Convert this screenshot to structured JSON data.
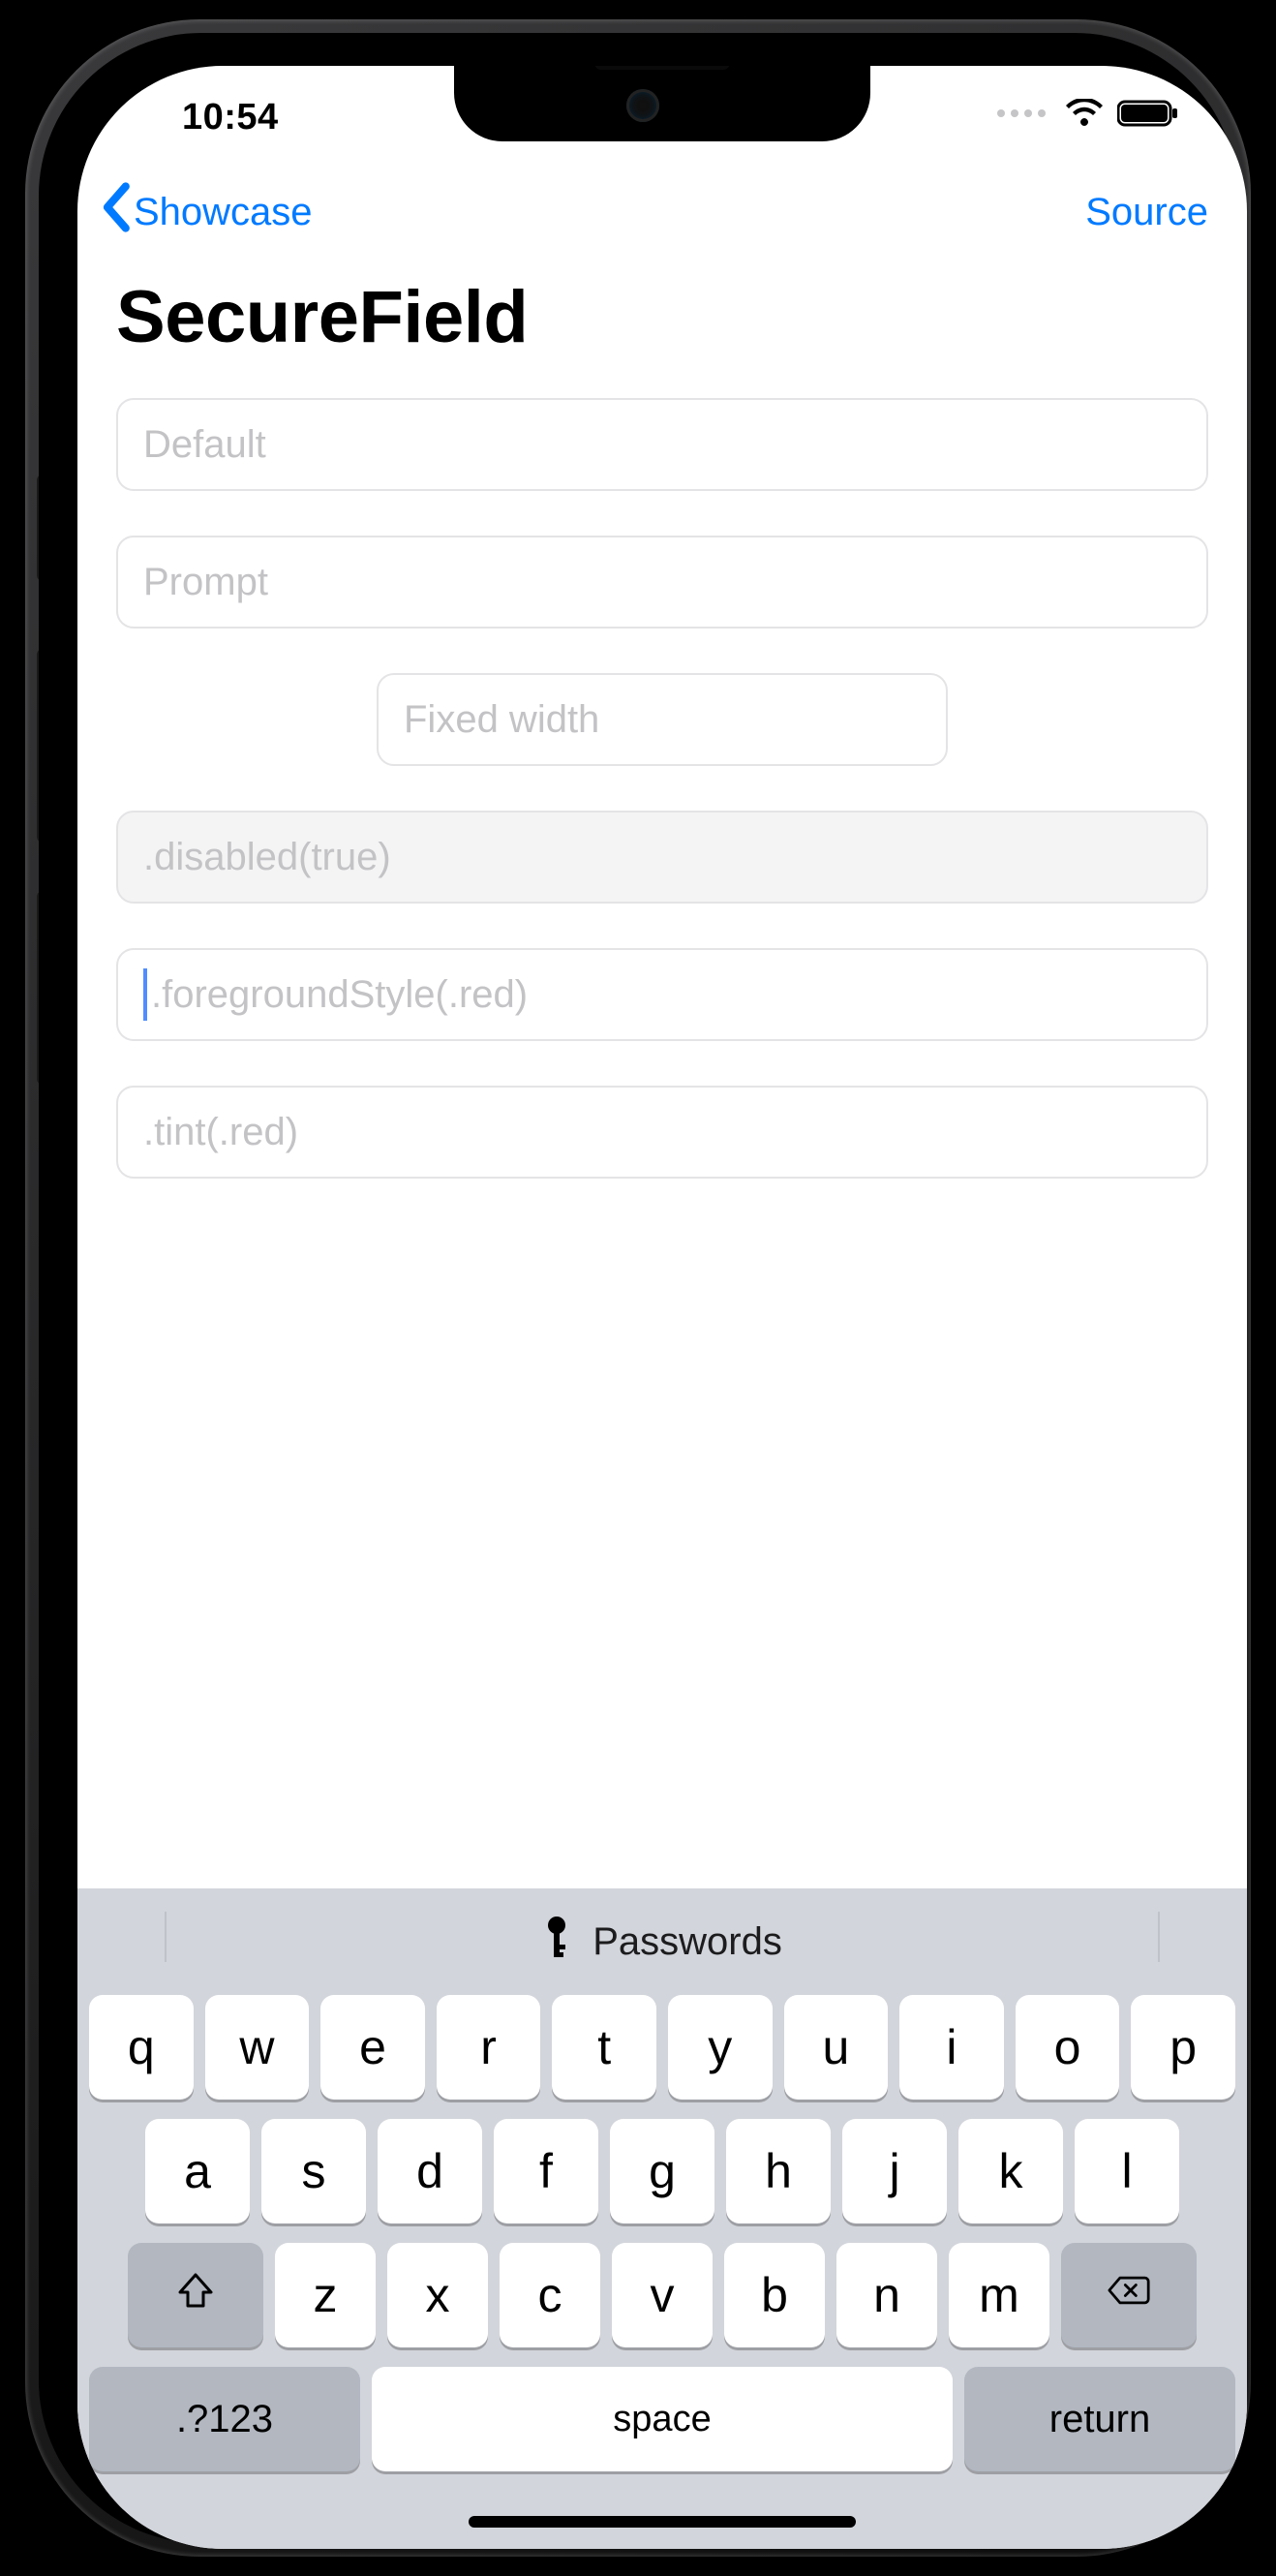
{
  "status": {
    "time": "10:54"
  },
  "nav": {
    "back_label": "Showcase",
    "source_label": "Source"
  },
  "title": "SecureField",
  "fields": {
    "f0": "Default",
    "f1": "Prompt",
    "f2": "Fixed width",
    "f3": ".disabled(true)",
    "f4": ".foregroundStyle(.red)",
    "f5": ".tint(.red)"
  },
  "keyboard": {
    "passwords_label": "Passwords",
    "row1": [
      "q",
      "w",
      "e",
      "r",
      "t",
      "y",
      "u",
      "i",
      "o",
      "p"
    ],
    "row2": [
      "a",
      "s",
      "d",
      "f",
      "g",
      "h",
      "j",
      "k",
      "l"
    ],
    "row3": [
      "z",
      "x",
      "c",
      "v",
      "b",
      "n",
      "m"
    ],
    "symnum": ".?123",
    "space": "space",
    "return": "return"
  }
}
